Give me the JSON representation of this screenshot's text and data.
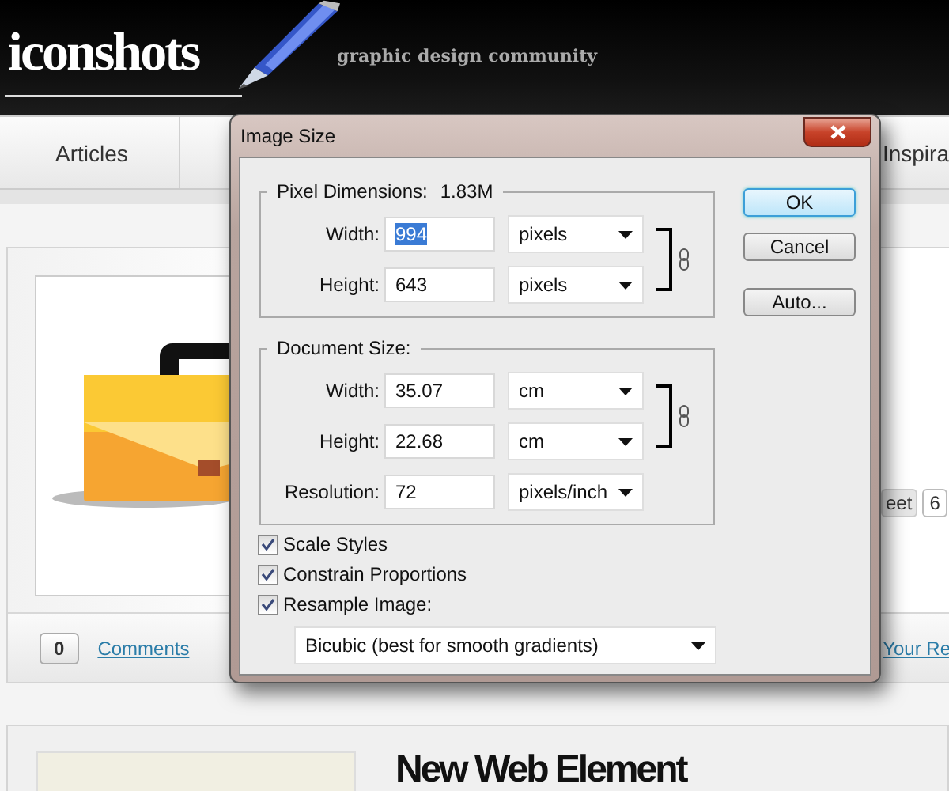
{
  "site": {
    "logo": "iconshots",
    "tagline": "graphic design community"
  },
  "nav": [
    {
      "label": "Articles"
    },
    {
      "label": "Inspira"
    }
  ],
  "post": {
    "comment_count": "0",
    "comments_link": "Comments",
    "tweet_label": "eet",
    "tweet_count": "6",
    "reply_link": "Your Re"
  },
  "next_post": {
    "title": "New Web Element"
  },
  "dialog": {
    "title": "Image Size",
    "pixel_dimensions": {
      "legend": "Pixel Dimensions:",
      "size": "1.83M",
      "fields": [
        {
          "label": "Width:",
          "value": "994",
          "unit": "pixels",
          "selected": true,
          "linked": true
        },
        {
          "label": "Height:",
          "value": "643",
          "unit": "pixels",
          "selected": false,
          "linked": true
        }
      ]
    },
    "document_size": {
      "legend": "Document Size:",
      "fields": [
        {
          "label": "Width:",
          "value": "35.07",
          "unit": "cm",
          "selected": false,
          "linked": true
        },
        {
          "label": "Height:",
          "value": "22.68",
          "unit": "cm",
          "selected": false,
          "linked": true
        },
        {
          "label": "Resolution:",
          "value": "72",
          "unit": "pixels/inch",
          "selected": false,
          "linked": false
        }
      ]
    },
    "options": [
      {
        "label": "Scale Styles",
        "checked": true
      },
      {
        "label": "Constrain Proportions",
        "checked": true
      },
      {
        "label": "Resample Image:",
        "checked": true
      }
    ],
    "resample_method": "Bicubic (best for smooth gradients)",
    "buttons": [
      {
        "label": "OK",
        "default": true
      },
      {
        "label": "Cancel",
        "default": false
      },
      {
        "label": "Auto...",
        "default": false
      }
    ]
  }
}
